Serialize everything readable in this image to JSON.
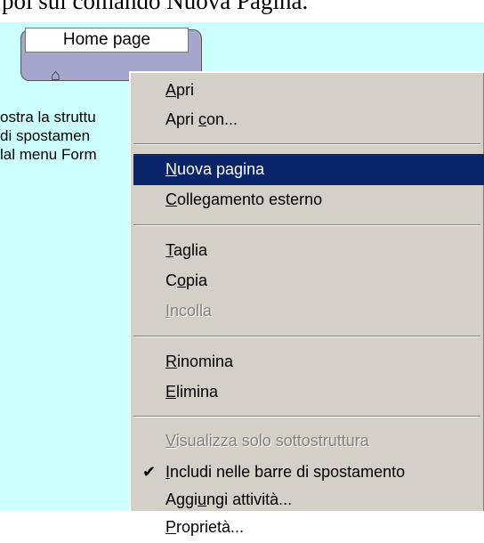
{
  "caption": "poi sul comando Nuova Pagina.",
  "node": {
    "label": "Home page",
    "icon": "home-icon"
  },
  "side_text": [
    "ostra la struttu",
    " di spostamen",
    "lal menu Form"
  ],
  "menu": {
    "items": [
      {
        "id": "apri",
        "pre": "",
        "u": "A",
        "post": "pri",
        "state": "normal"
      },
      {
        "id": "apri-con",
        "pre": "Apri ",
        "u": "c",
        "post": "on...",
        "state": "normal"
      },
      {
        "id": "nuova-pagina",
        "pre": "",
        "u": "N",
        "post": "uova pagina",
        "state": "highlighted"
      },
      {
        "id": "collegamento-esterno",
        "pre": "",
        "u": "C",
        "post": "ollegamento esterno",
        "state": "normal"
      },
      {
        "id": "taglia",
        "pre": "",
        "u": "T",
        "post": "aglia",
        "state": "normal"
      },
      {
        "id": "copia",
        "pre": "C",
        "u": "o",
        "post": "pia",
        "state": "normal"
      },
      {
        "id": "incolla",
        "pre": "",
        "u": "I",
        "post": "ncolla",
        "state": "disabled"
      },
      {
        "id": "rinomina",
        "pre": "",
        "u": "R",
        "post": "inomina",
        "state": "normal"
      },
      {
        "id": "elimina",
        "pre": "",
        "u": "E",
        "post": "limina",
        "state": "normal"
      },
      {
        "id": "visualizza-solo-sottostruttura",
        "pre": "",
        "u": "V",
        "post": "isualizza solo sottostruttura",
        "state": "disabled"
      },
      {
        "id": "includi-nelle-barre",
        "pre": "",
        "u": "I",
        "post": "ncludi nelle barre di spostamento",
        "state": "checked"
      },
      {
        "id": "aggiungi-attivita",
        "pre": "Aggi",
        "u": "u",
        "post": "ngi attività...",
        "state": "normal"
      },
      {
        "id": "proprieta",
        "pre": "",
        "u": "P",
        "post": "roprietà...",
        "state": "normal"
      }
    ],
    "check_icon": "checkmark-icon"
  }
}
